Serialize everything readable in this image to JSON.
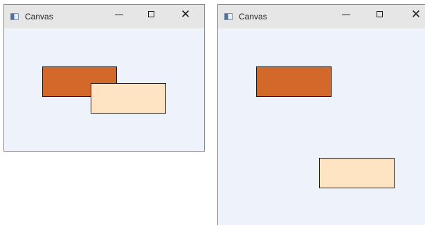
{
  "windows": [
    {
      "title": "Canvas",
      "background": "#eef2fb",
      "shapes": [
        {
          "name": "orange",
          "fill": "#d2692a"
        },
        {
          "name": "bisque",
          "fill": "#ffe4c4"
        }
      ]
    },
    {
      "title": "Canvas",
      "background": "#eef2fb",
      "shapes": [
        {
          "name": "orange",
          "fill": "#d2692a"
        },
        {
          "name": "bisque",
          "fill": "#ffe4c4"
        }
      ]
    }
  ],
  "titlebar_controls": {
    "minimize_icon": "minimize-icon",
    "maximize_icon": "maximize-icon",
    "close_icon": "close-icon",
    "close_glyph": "✕"
  }
}
